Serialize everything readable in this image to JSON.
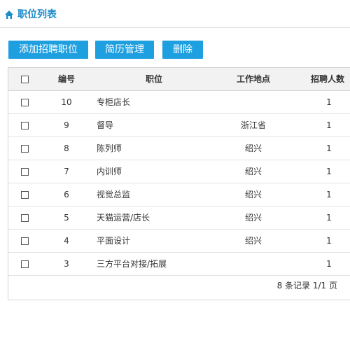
{
  "page": {
    "title": "职位列表",
    "accent": "#1a8bc9",
    "button_color": "#1e9fe0"
  },
  "toolbar": {
    "add_label": "添加招聘职位",
    "resume_label": "简历管理",
    "delete_label": "删除"
  },
  "table": {
    "columns": {
      "id": "编号",
      "position": "职位",
      "location": "工作地点",
      "count": "招聘人数"
    },
    "rows": [
      {
        "id": "10",
        "position": "专柜店长",
        "location": "",
        "count": "1"
      },
      {
        "id": "9",
        "position": "督导",
        "location": "浙江省",
        "count": "1"
      },
      {
        "id": "8",
        "position": "陈列师",
        "location": "绍兴",
        "count": "1"
      },
      {
        "id": "7",
        "position": "内训师",
        "location": "绍兴",
        "count": "1"
      },
      {
        "id": "6",
        "position": "视觉总监",
        "location": "绍兴",
        "count": "1"
      },
      {
        "id": "5",
        "position": "天猫运营/店长",
        "location": "绍兴",
        "count": "1"
      },
      {
        "id": "4",
        "position": "平面设计",
        "location": "绍兴",
        "count": "1"
      },
      {
        "id": "3",
        "position": "三方平台对接/拓展",
        "location": "",
        "count": "1"
      }
    ]
  },
  "pagination": {
    "summary": "8 条记录 1/1 页"
  },
  "icons": {
    "home": "home-icon"
  }
}
